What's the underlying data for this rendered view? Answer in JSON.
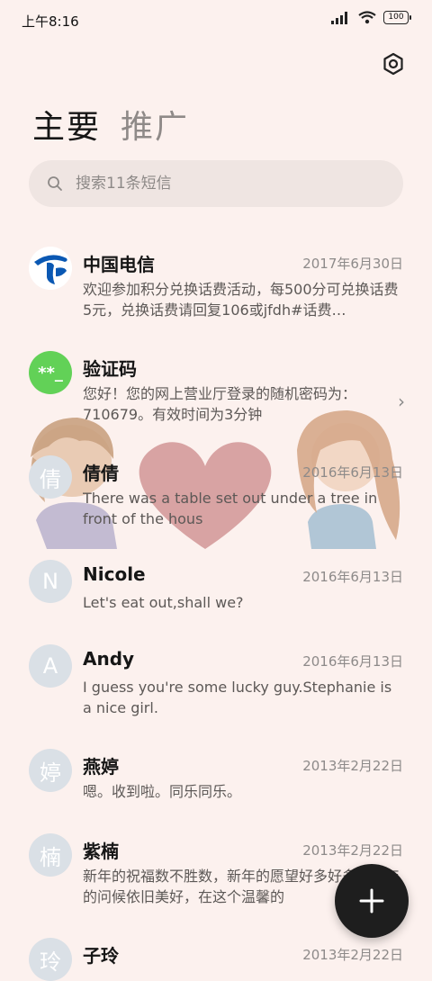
{
  "status": {
    "time": "上午8:16",
    "battery": "100"
  },
  "header": {
    "settings_icon": "settings-icon",
    "tabs": [
      {
        "label": "主要",
        "active": true
      },
      {
        "label": "推广",
        "active": false
      }
    ]
  },
  "search": {
    "placeholder": "搜索11条短信",
    "value": ""
  },
  "conversations": [
    {
      "name": "中国电信",
      "date": "2017年6月30日",
      "preview": "欢迎参加积分兑换话费活动，每500分可兑换话费5元，兑换话费请回复106或jfdh#话费…",
      "avatar": "telecom-logo"
    },
    {
      "name": "验证码",
      "date": "",
      "preview": "您好！您的网上营业厅登录的随机密码为：710679。有效时间为3分钟",
      "avatar_text": "**_",
      "avatar_color": "#62D157"
    },
    {
      "name": "倩倩",
      "date": "2016年6月13日",
      "preview": "There was a table set out under a tree in front of the hous",
      "avatar_text": "倩"
    },
    {
      "name": "Nicole",
      "date": "2016年6月13日",
      "preview": "Let's eat out,shall we?",
      "avatar_text": "N"
    },
    {
      "name": "Andy",
      "date": "2016年6月13日",
      "preview": "I guess you're some lucky guy.Stephanie is a nice girl.",
      "avatar_text": "A"
    },
    {
      "name": "燕婷",
      "date": "2013年2月22日",
      "preview": "嗯。收到啦。同乐同乐。",
      "avatar_text": "婷"
    },
    {
      "name": "紫楠",
      "date": "2013年2月22日",
      "preview": "新年的祝福数不胜数，新年的愿望好多好多，新年的问候依旧美好，在这个温馨的",
      "avatar_text": "楠"
    },
    {
      "name": "子玲",
      "date": "2013年2月22日",
      "preview": "",
      "avatar_text": "玲"
    }
  ],
  "fab": {
    "icon": "plus-icon"
  },
  "colors": {
    "background": "#FCF1EE",
    "avatar_default": "#DAE0E6",
    "accent_dark": "#1E1E1E",
    "verify_green": "#62D157",
    "telecom_blue": "#0A58B3"
  }
}
